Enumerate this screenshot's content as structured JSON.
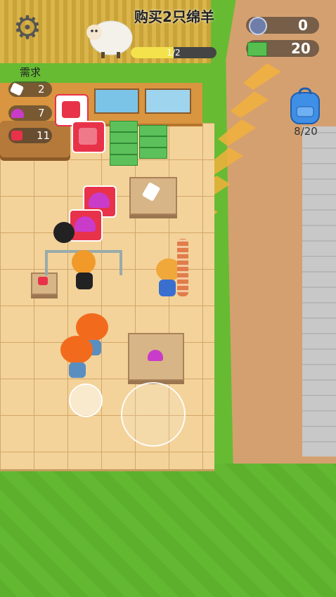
{
  "hud": {
    "settings_icon": "gear-icon",
    "quest": {
      "title": "购买2只绵羊",
      "progress_text": "1/2",
      "progress_fraction": 0.5
    },
    "currencies": [
      {
        "icon": "gem-icon",
        "value": "0"
      },
      {
        "icon": "cash-icon",
        "value": "20"
      }
    ],
    "demand": {
      "title": "需求",
      "items": [
        {
          "icon": "wool-icon",
          "value": "2"
        },
        {
          "icon": "hat-icon",
          "value": "7"
        },
        {
          "icon": "shirt-icon",
          "value": "11"
        }
      ]
    },
    "backpack": {
      "icon": "backpack-icon",
      "capacity_text": "8/20"
    }
  },
  "colors": {
    "accent_progress": "#f3e24b",
    "bubble_red": "#e8324a",
    "grass": "#66bb33",
    "floor": "#f3d39a"
  }
}
